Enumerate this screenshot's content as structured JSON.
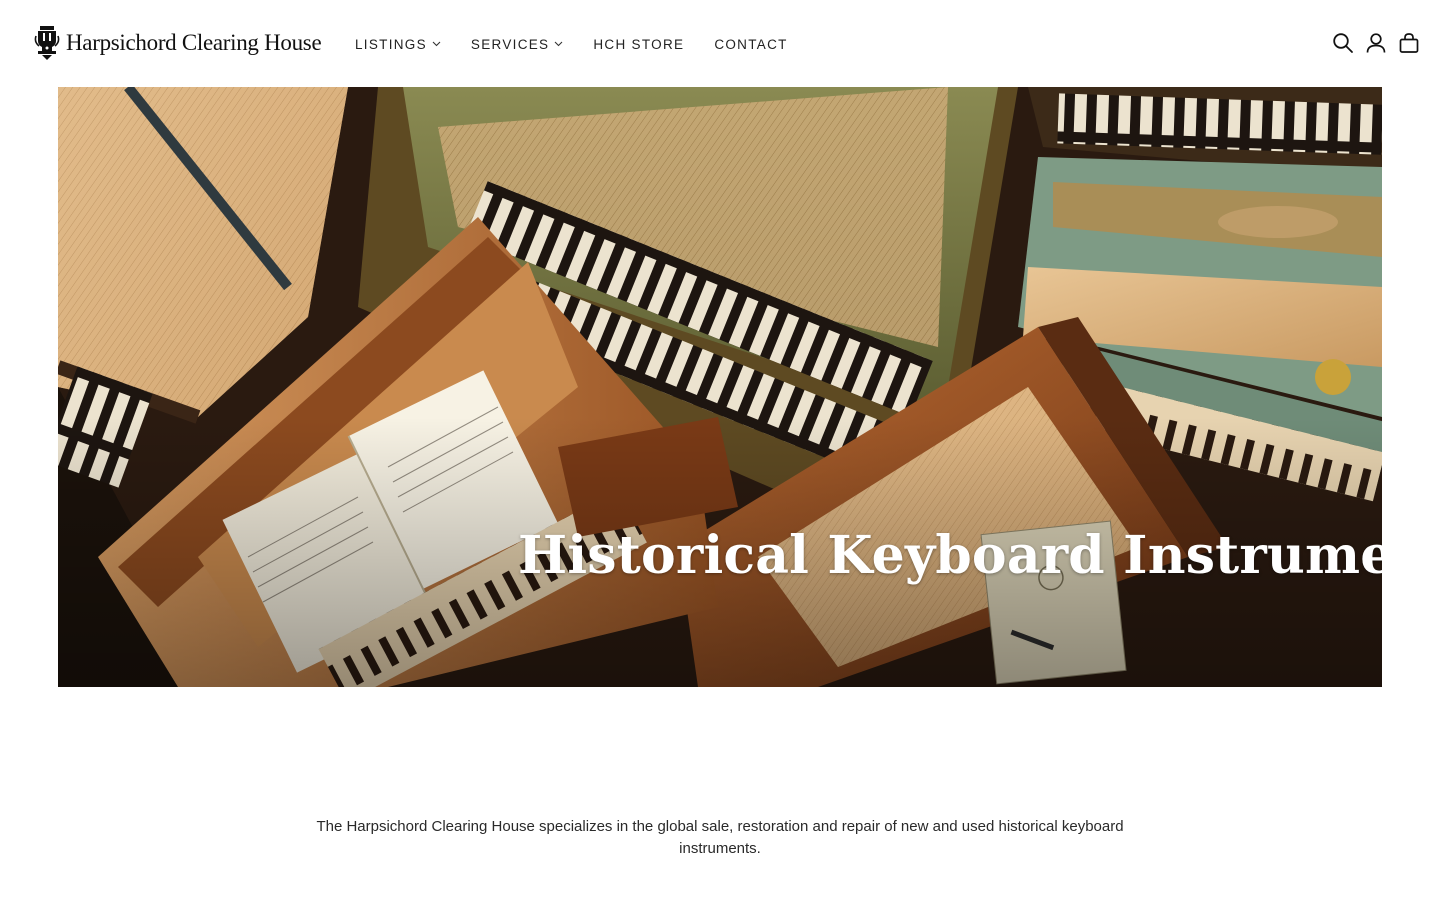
{
  "brand": {
    "name": "Harpsichord Clearing House",
    "logo_icon": "crest-emblem-icon"
  },
  "nav": {
    "items": [
      {
        "label": "LISTINGS",
        "has_dropdown": true
      },
      {
        "label": "SERVICES",
        "has_dropdown": true
      },
      {
        "label": "HCH STORE",
        "has_dropdown": false
      },
      {
        "label": "CONTACT",
        "has_dropdown": false
      }
    ]
  },
  "header_icons": [
    "search-icon",
    "account-icon",
    "cart-bag-icon"
  ],
  "hero": {
    "title": "Historical Keyboard Instruments",
    "image_subject": "overhead view of several harpsichords with open lids and sheet music"
  },
  "intro": {
    "text": "The Harpsichord Clearing House specializes in the global sale, restoration and repair of new and used historical keyboard instruments."
  },
  "colors": {
    "background": "#ffffff",
    "text": "#1c1c1c",
    "hero_title": "#ffffff"
  }
}
